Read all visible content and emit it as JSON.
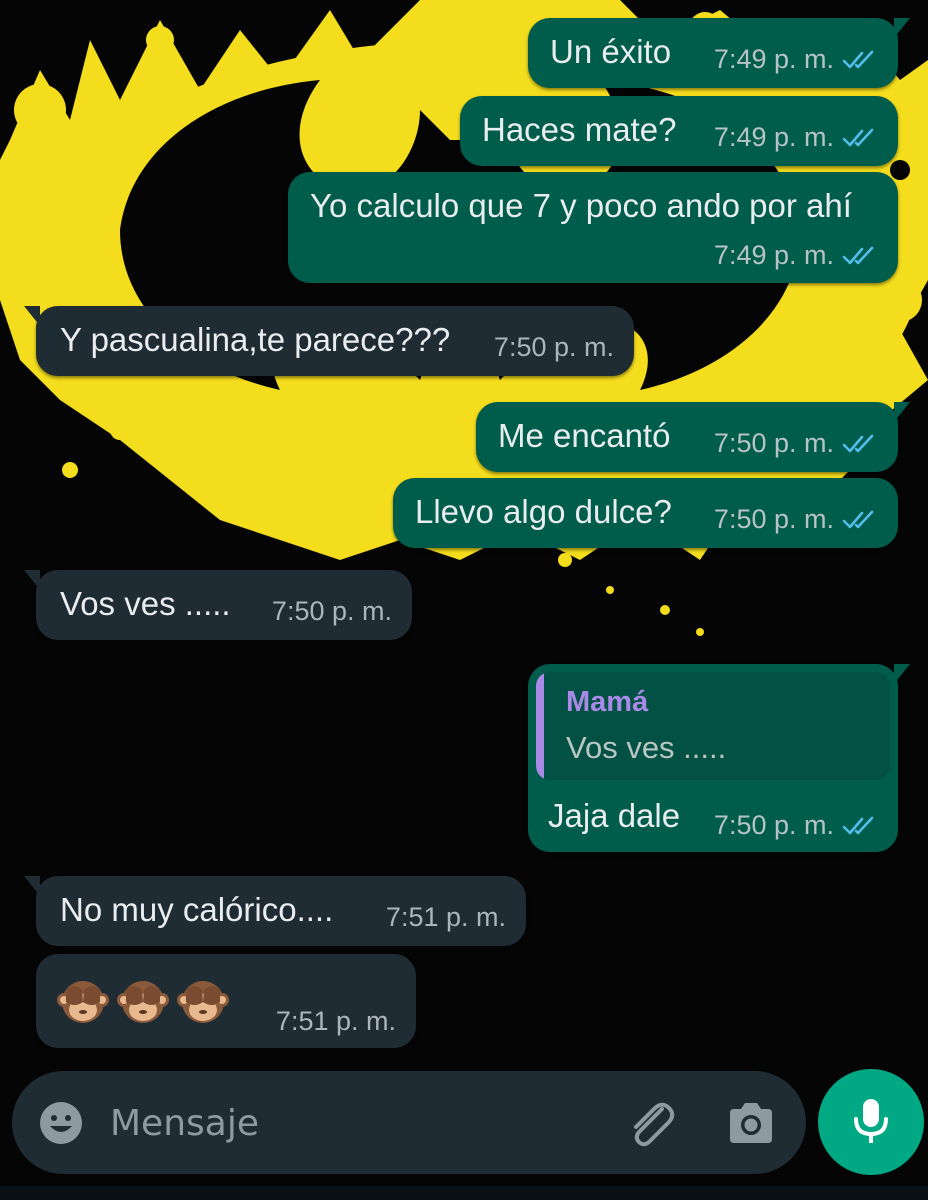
{
  "theme": {
    "outgoing_bubble": "#005c4b",
    "incoming_bubble": "#202c33",
    "read_ticks": "#53bdeb",
    "quote_accent": "#a98ae6",
    "send_button": "#00a884",
    "wallpaper_accent": "#f4dd1c"
  },
  "wallpaper": {
    "description_icon": "bat-emblem-splash"
  },
  "messages": [
    {
      "direction": "out",
      "text": "Un éxito",
      "time": "7:49 p. m.",
      "status": "read"
    },
    {
      "direction": "out",
      "text": "Haces mate?",
      "time": "7:49 p. m.",
      "status": "read"
    },
    {
      "direction": "out",
      "text": "Yo calculo que 7 y poco ando por ahí",
      "time": "7:49 p. m.",
      "status": "read"
    },
    {
      "direction": "in",
      "text": "Y pascualina,te parece???",
      "time": "7:50 p. m."
    },
    {
      "direction": "out",
      "text": "Me encantó",
      "time": "7:50 p. m.",
      "status": "read"
    },
    {
      "direction": "out",
      "text": "Llevo algo dulce?",
      "time": "7:50 p. m.",
      "status": "read"
    },
    {
      "direction": "in",
      "text": "Vos ves .....",
      "time": "7:50 p. m."
    },
    {
      "direction": "out",
      "quote": {
        "author": "Mamá",
        "text": "Vos ves ....."
      },
      "text": "Jaja dale",
      "time": "7:50 p. m.",
      "status": "read"
    },
    {
      "direction": "in",
      "text": "No muy calórico....",
      "time": "7:51 p. m."
    },
    {
      "direction": "in",
      "emoji": [
        "see-no-evil-monkey-icon",
        "see-no-evil-monkey-icon",
        "see-no-evil-monkey-icon"
      ],
      "time": "7:51 p. m."
    }
  ],
  "composer": {
    "placeholder": "Mensaje",
    "icons": [
      "emoji-icon",
      "attach-paperclip-icon",
      "camera-icon",
      "microphone-icon"
    ]
  }
}
